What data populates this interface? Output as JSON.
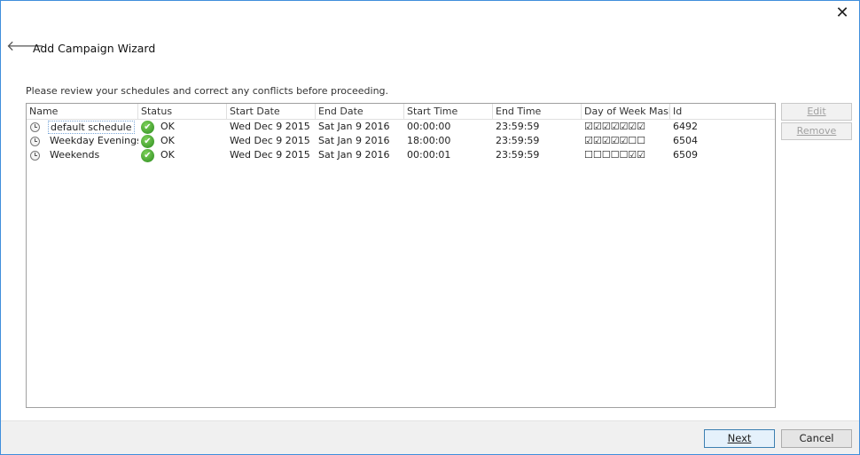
{
  "window": {
    "close_glyph": "✕",
    "back_glyph": "🡐"
  },
  "header": {
    "title": "Add Campaign Wizard"
  },
  "instructions": "Please review your schedules and correct any conflicts before proceeding.",
  "table": {
    "columns": [
      "Name",
      "Status",
      "Start Date",
      "End Date",
      "Start Time",
      "End Time",
      "Day of Week Mask",
      "Id"
    ],
    "rows": [
      {
        "name": "default schedule",
        "status": "OK",
        "start_date": "Wed Dec 9 2015",
        "end_date": "Sat Jan 9 2016",
        "start_time": "00:00:00",
        "end_time": "23:59:59",
        "mask": "☑☑☑☑☑☑☑",
        "id": "6492"
      },
      {
        "name": "Weekday Evenings",
        "status": "OK",
        "start_date": "Wed Dec 9 2015",
        "end_date": "Sat Jan 9 2016",
        "start_time": "18:00:00",
        "end_time": "23:59:59",
        "mask": "☑☑☑☑☑☐☐",
        "id": "6504"
      },
      {
        "name": "Weekends",
        "status": "OK",
        "start_date": "Wed Dec 9 2015",
        "end_date": "Sat Jan 9 2016",
        "start_time": "00:00:01",
        "end_time": "23:59:59",
        "mask": "☐☐☐☐☐☑☑",
        "id": "6509"
      }
    ]
  },
  "side_buttons": {
    "edit": "Edit",
    "remove": "Remove"
  },
  "footer": {
    "next": "Next",
    "cancel": "Cancel"
  },
  "icons": {
    "ok_check": "✔"
  },
  "colors": {
    "ok_green": "#2b8a1e",
    "window_border": "#3f8edc"
  }
}
